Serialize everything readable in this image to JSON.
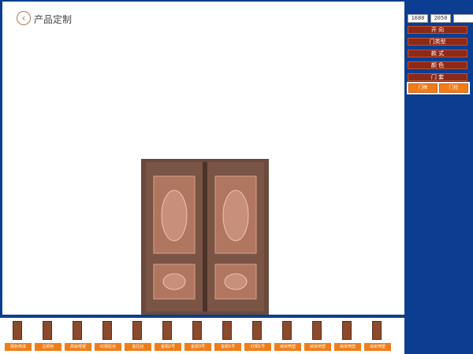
{
  "header": {
    "title": "产品定制",
    "back_icon": "chevron-left-icon"
  },
  "dimensions": {
    "width": "1680",
    "height": "2050",
    "extra": ""
  },
  "menu": [
    {
      "label": "开  向"
    },
    {
      "label": "门类型"
    },
    {
      "label": "款  式"
    },
    {
      "label": "颜  色"
    },
    {
      "label": "门  套"
    }
  ],
  "sub_buttons": [
    {
      "label": "门框"
    },
    {
      "label": "门柱"
    }
  ],
  "thumbnails": [
    {
      "label": "铜色喷漆"
    },
    {
      "label": "古铜色"
    },
    {
      "label": "高级哑银"
    },
    {
      "label": "红铜拉丝"
    },
    {
      "label": "金拉丝"
    },
    {
      "label": "金铜2号"
    },
    {
      "label": "金铜3号"
    },
    {
      "label": "金铜5号"
    },
    {
      "label": "红铜1号"
    },
    {
      "label": "纳米喷塑"
    },
    {
      "label": "纳米喷塑"
    },
    {
      "label": "纳米喷塑"
    },
    {
      "label": "纳米喷塑"
    }
  ]
}
